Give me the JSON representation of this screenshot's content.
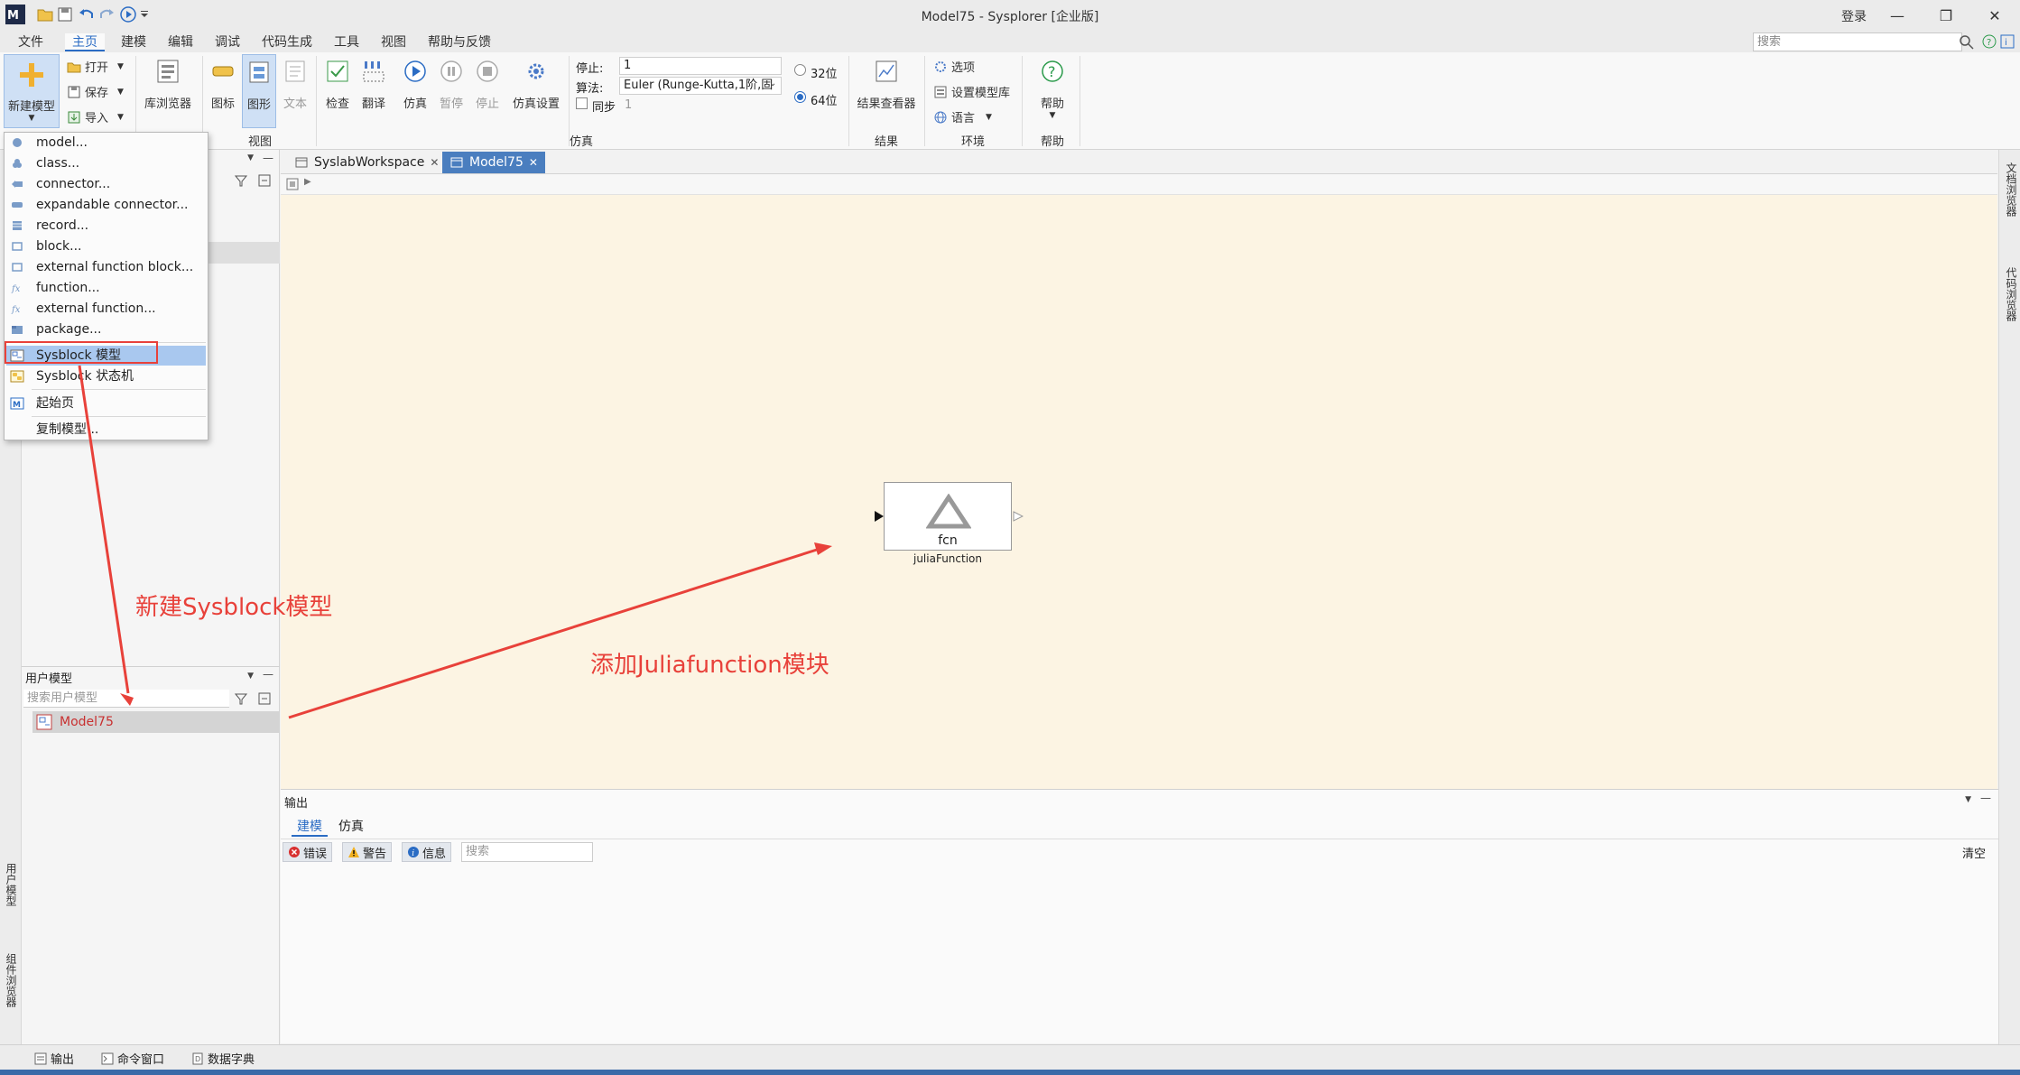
{
  "window": {
    "title": "Model75 - Sysplorer [企业版]",
    "login": "登录"
  },
  "menu": {
    "items": [
      "文件",
      "主页",
      "建模",
      "编辑",
      "调试",
      "代码生成",
      "工具",
      "视图",
      "帮助与反馈"
    ],
    "active": "主页",
    "search_placeholder": "搜索"
  },
  "ribbon": {
    "new_model": "新建模型",
    "open": "打开",
    "save": "保存",
    "import": "导入",
    "library_browser": "库浏览器",
    "icon_view": "图标",
    "graphic_view": "图形",
    "text_view": "文本",
    "check": "检查",
    "translate": "翻译",
    "simulate": "仿真",
    "pause": "暂停",
    "stop": "停止",
    "sim_settings": "仿真设置",
    "stop_label": "停止:",
    "stop_value": "1",
    "algo_label": "算法:",
    "algo_value": "Euler (Runge-Kutta,1阶,固",
    "sync_label": "同步",
    "sync_value": "1",
    "bit32": "32位",
    "bit64": "64位",
    "selected_bits": "64位",
    "result_viewer": "结果查看器",
    "options": "选项",
    "set_model_lib": "设置模型库",
    "language": "语言",
    "help": "帮助",
    "groups": {
      "view": "视图",
      "simulation": "仿真",
      "results": "结果",
      "environment": "环境",
      "help": "帮助"
    }
  },
  "dropdown": {
    "items": [
      {
        "label": "model...",
        "icon": "model-icon"
      },
      {
        "label": "class...",
        "icon": "class-icon"
      },
      {
        "label": "connector...",
        "icon": "connector-icon"
      },
      {
        "label": "expandable connector...",
        "icon": "expandable-connector-icon"
      },
      {
        "label": "record...",
        "icon": "record-icon"
      },
      {
        "label": "block...",
        "icon": "block-icon"
      },
      {
        "label": "external function block...",
        "icon": "external-function-block-icon"
      },
      {
        "label": "function...",
        "icon": "function-icon"
      },
      {
        "label": "external function...",
        "icon": "external-function-icon"
      },
      {
        "label": "package...",
        "icon": "package-icon"
      },
      {
        "label": "Sysblock 模型",
        "icon": "sysblock-model-icon"
      },
      {
        "label": "Sysblock 状态机",
        "icon": "sysblock-statemachine-icon"
      },
      {
        "label": "起始页",
        "icon": "start-page-icon"
      },
      {
        "label": "复制模型...",
        "icon": ""
      }
    ],
    "selected": "Sysblock 模型"
  },
  "tabs": [
    {
      "label": "SyslabWorkspace",
      "active": false
    },
    {
      "label": "Model75",
      "active": true
    }
  ],
  "user_models": {
    "title": "用户模型",
    "search_placeholder": "搜索用户模型",
    "items": [
      "Model75"
    ]
  },
  "left_strip": {
    "user_model": "用户模型",
    "component_browser": "组件浏览器"
  },
  "right_strip": {
    "doc_browser": "文档浏览器",
    "code_browser": "代码浏览器"
  },
  "block": {
    "name": "fcn",
    "label": "juliaFunction"
  },
  "annotations": {
    "new_sysblock": "新建Sysblock模型",
    "add_julia": "添加Juliafunction模块"
  },
  "output": {
    "title": "输出",
    "tabs": [
      "建模",
      "仿真"
    ],
    "active_tab": "建模",
    "errors": "错误",
    "warnings": "警告",
    "info": "信息",
    "search_placeholder": "搜索",
    "clear": "清空"
  },
  "statusbar": {
    "output": "输出",
    "command_window": "命令窗口",
    "data_dictionary": "数据字典"
  },
  "colors": {
    "accent": "#2b6cc4",
    "canvas_bg": "#fcf4e3",
    "annotation": "#e8413a",
    "tab_active": "#4a7ebf"
  }
}
